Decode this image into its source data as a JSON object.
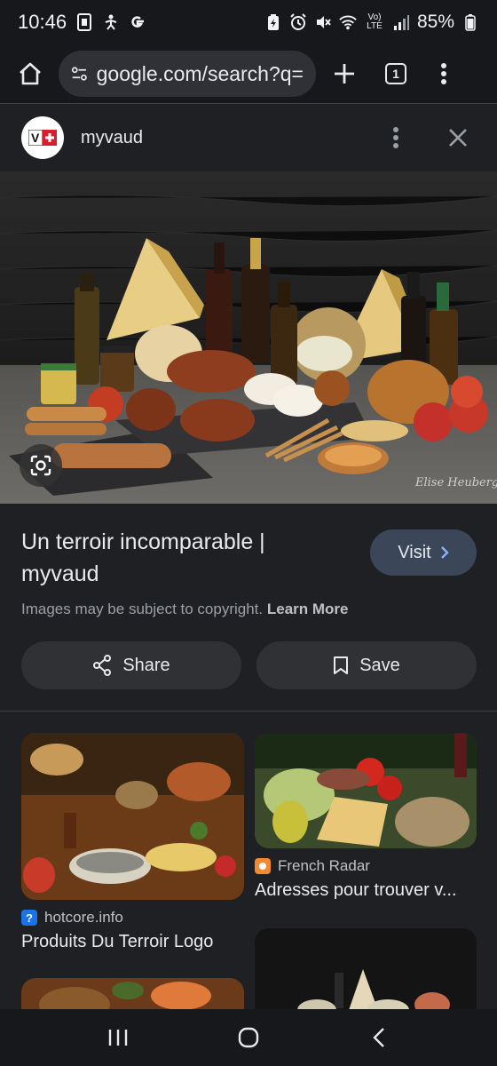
{
  "status_bar": {
    "time": "10:46",
    "left_icons": [
      "sim-icon",
      "accessibility-icon",
      "google-g-icon"
    ],
    "right_icons": [
      "battery-saver-icon",
      "alarm-icon",
      "mute-icon",
      "wifi-icon",
      "volte-icon",
      "signal-icon"
    ],
    "volte_label": "Vo)\nLTE",
    "battery": "85%"
  },
  "browser": {
    "url": "google.com/search?q=",
    "tab_count": "1"
  },
  "result": {
    "source_name": "myvaud",
    "title": "Un terroir incomparable | myvaud",
    "visit_label": "Visit",
    "copyright_text": "Images may be subject to copyright.",
    "learn_more": "Learn More",
    "share_label": "Share",
    "save_label": "Save",
    "watermark": "Elise Heuberger"
  },
  "related": [
    {
      "source": "hotcore.info",
      "title": "Produits Du Terroir Logo",
      "favicon": "?",
      "favicon_color": "#1a73e8"
    },
    {
      "source": "French Radar",
      "title": "Adresses pour trouver v...",
      "favicon": "",
      "favicon_color": "#f28b30"
    },
    {
      "source": "",
      "title": ""
    },
    {
      "source": "",
      "title": ""
    }
  ],
  "colors": {
    "background": "#1f2023",
    "bar": "#17181b",
    "visit_button": "#3b4658",
    "chip": "#303134"
  }
}
